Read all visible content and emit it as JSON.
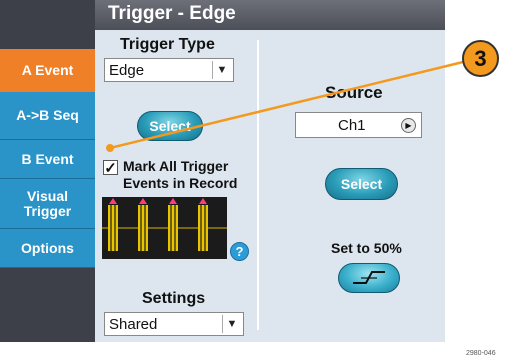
{
  "dialog": {
    "title": "Trigger - Edge"
  },
  "tabs": [
    {
      "label": "A Event",
      "active": true
    },
    {
      "label": "A->B Seq",
      "active": false
    },
    {
      "label": "B Event",
      "active": false
    },
    {
      "label": "Visual Trigger",
      "active": false
    },
    {
      "label": "Options",
      "active": false
    }
  ],
  "trigger_type": {
    "label": "Trigger Type",
    "value": "Edge",
    "select_label": "Select"
  },
  "mark_all": {
    "checked": true,
    "label_line1": "Mark All Trigger",
    "label_line2": "Events in Record"
  },
  "help": {
    "glyph": "?"
  },
  "settings": {
    "label": "Settings",
    "value": "Shared"
  },
  "source": {
    "label": "Source",
    "value": "Ch1",
    "select_label": "Select"
  },
  "set50": {
    "label": "Set to 50%",
    "icon": "rising-edge-icon"
  },
  "callout": {
    "number": "3"
  },
  "figure_code": "2980-046",
  "colors": {
    "active_tab": "#f08028",
    "tab_blue": "#2a93c8",
    "title_bar": "#55575f",
    "callout": "#f39a1e",
    "button_teal": "#2a9cb8"
  }
}
